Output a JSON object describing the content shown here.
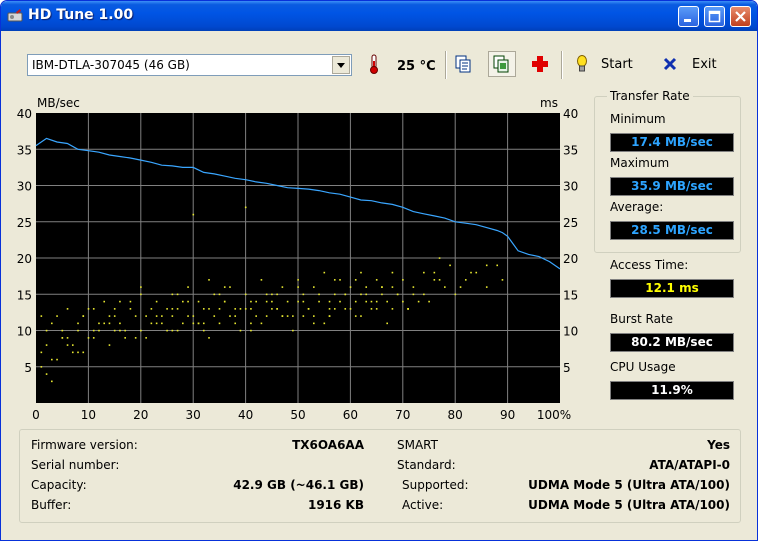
{
  "window": {
    "title": "HD Tune 1.00"
  },
  "toolbar": {
    "drive_selected": "IBM-DTLA-307045 (46 GB)",
    "temperature": "25 °C",
    "start_label": "Start",
    "exit_label": "Exit"
  },
  "transfer_rate": {
    "group_title": "Transfer Rate",
    "minimum_label": "Minimum",
    "minimum_value": "17.4 MB/sec",
    "maximum_label": "Maximum",
    "maximum_value": "35.9 MB/sec",
    "average_label": "Average:",
    "average_value": "28.5 MB/sec"
  },
  "access_time": {
    "label": "Access Time:",
    "value": "12.1 ms"
  },
  "burst_rate": {
    "label": "Burst Rate",
    "value": "80.2 MB/sec"
  },
  "cpu_usage": {
    "label": "CPU Usage",
    "value": "11.9%"
  },
  "info": {
    "firmware_label": "Firmware version:",
    "firmware_value": "TX6OA6AA",
    "serial_label": "Serial number:",
    "serial_value": "",
    "capacity_label": "Capacity:",
    "capacity_value": "42.9 GB (~46.1 GB)",
    "buffer_label": "Buffer:",
    "buffer_value": "1916 KB",
    "smart_label": "SMART",
    "smart_value": "Yes",
    "standard_label": "Standard:",
    "standard_value": "ATA/ATAPI-0",
    "supported_label": "Supported:",
    "supported_value": "UDMA Mode 5 (Ultra ATA/100)",
    "active_label": "Active:",
    "active_value": "UDMA Mode 5 (Ultra ATA/100)"
  },
  "colors": {
    "plot_bg": "#000000",
    "grid": "#808080",
    "transfer_line": "#3aa6ff",
    "access_dots": "#e8e830"
  },
  "chart_data": {
    "type": "line",
    "ylabel_left": "MB/sec",
    "ylabel_right": "ms",
    "x_ticks": [
      "0",
      "10",
      "20",
      "30",
      "40",
      "50",
      "60",
      "70",
      "80",
      "90",
      "100%"
    ],
    "y_ticks": [
      "5",
      "10",
      "15",
      "20",
      "25",
      "30",
      "35",
      "40"
    ],
    "xlim": [
      0,
      100
    ],
    "ylim": [
      0,
      40
    ],
    "grid": true,
    "series": [
      {
        "x": [
          0,
          2,
          4,
          6,
          8,
          10,
          12,
          14,
          16,
          18,
          20,
          22,
          24,
          26,
          28,
          30,
          32,
          34,
          36,
          38,
          40,
          42,
          44,
          46,
          48,
          50,
          52,
          54,
          56,
          58,
          60,
          62,
          64,
          66,
          68,
          70,
          72,
          74,
          76,
          78,
          80,
          82,
          84,
          86,
          88,
          89,
          90,
          91,
          92,
          94,
          96,
          98,
          100
        ],
        "values": [
          35.5,
          36.5,
          36.0,
          35.8,
          35.0,
          34.8,
          34.6,
          34.2,
          34.0,
          33.8,
          33.5,
          33.2,
          32.8,
          32.7,
          32.5,
          32.5,
          31.8,
          31.6,
          31.3,
          31.0,
          30.8,
          30.5,
          30.3,
          30.0,
          29.7,
          29.6,
          29.5,
          29.3,
          29.0,
          28.8,
          28.4,
          28.0,
          27.9,
          27.6,
          27.4,
          27.0,
          26.4,
          26.1,
          25.8,
          25.5,
          25.0,
          24.8,
          24.6,
          24.2,
          23.8,
          23.5,
          23.0,
          22.0,
          21.0,
          20.5,
          20.2,
          19.5,
          18.5
        ]
      },
      {
        "x": [
          1,
          2,
          3,
          4,
          5,
          6,
          7,
          8,
          9,
          10,
          12,
          13,
          14,
          15,
          16,
          18,
          19,
          20,
          22,
          23,
          24,
          25,
          26,
          27,
          28,
          29,
          30,
          31,
          32,
          33,
          34,
          35,
          36,
          37,
          38,
          39,
          40,
          41,
          42,
          43,
          44,
          45,
          46,
          47,
          48,
          49,
          50,
          51,
          52,
          53,
          54,
          55,
          56,
          57,
          58,
          59,
          60,
          61,
          62,
          63,
          64,
          65,
          66,
          67,
          68,
          69,
          70,
          71,
          72,
          74,
          75,
          76,
          78,
          79,
          80,
          82,
          84,
          86,
          88,
          2,
          4,
          6,
          8,
          10,
          12,
          14,
          16,
          18,
          20,
          22,
          24,
          26,
          28,
          30,
          32,
          34,
          36,
          38,
          40,
          42,
          44,
          46,
          48,
          50,
          52,
          54,
          56,
          58,
          60,
          62,
          64,
          66,
          68,
          70,
          72,
          1,
          3,
          5,
          7,
          9,
          11,
          13,
          15,
          17,
          19,
          21,
          23,
          25,
          27,
          29,
          31,
          33,
          35,
          37,
          39,
          41,
          43,
          45,
          47,
          49,
          51,
          53,
          55,
          57,
          59,
          61,
          63,
          65,
          67,
          69,
          71,
          73,
          2,
          5,
          8,
          11,
          14,
          17,
          20,
          23,
          26,
          29,
          32,
          35,
          38,
          41,
          44,
          47,
          50,
          53,
          56,
          59,
          62,
          65,
          68,
          71,
          74,
          77,
          1,
          6,
          11,
          16,
          21,
          26,
          31,
          36,
          41,
          46,
          51,
          56,
          61,
          66,
          71,
          76,
          81,
          86,
          3,
          9,
          15,
          27,
          33,
          45,
          57,
          63,
          77,
          83,
          89,
          30,
          40
        ],
        "values": [
          5,
          8,
          11,
          6,
          9,
          13,
          7,
          10,
          12,
          9,
          11,
          14,
          8,
          12,
          10,
          13,
          9,
          15,
          11,
          14,
          12,
          10,
          15,
          13,
          11,
          16,
          12,
          14,
          10,
          13,
          15,
          11,
          14,
          16,
          12,
          13,
          15,
          11,
          14,
          17,
          12,
          15,
          13,
          16,
          14,
          12,
          17,
          15,
          13,
          16,
          14,
          18,
          12,
          15,
          17,
          13,
          16,
          14,
          18,
          15,
          13,
          17,
          16,
          14,
          18,
          15,
          17,
          13,
          16,
          18,
          14,
          17,
          16,
          19,
          15,
          17,
          18,
          16,
          19,
          10,
          12,
          9,
          11,
          13,
          10,
          12,
          11,
          14,
          10,
          13,
          11,
          12,
          14,
          11,
          13,
          12,
          14,
          11,
          13,
          12,
          15,
          13,
          12,
          14,
          13,
          15,
          12,
          14,
          13,
          15,
          14,
          16,
          13,
          14,
          15,
          7,
          6,
          10,
          8,
          12,
          9,
          11,
          13,
          10,
          12,
          9,
          11,
          13,
          10,
          12,
          11,
          9,
          13,
          12,
          10,
          14,
          11,
          13,
          12,
          10,
          14,
          12,
          11,
          13,
          15,
          12,
          14,
          13,
          11,
          15,
          13,
          14,
          4,
          9,
          7,
          13,
          11,
          9,
          16,
          12,
          10,
          14,
          11,
          15,
          13,
          10,
          14,
          12,
          16,
          11,
          13,
          15,
          12,
          14,
          16,
          13,
          15,
          17,
          12,
          8,
          10,
          14,
          12,
          13,
          11,
          16,
          13,
          15,
          12,
          14,
          17,
          15,
          13,
          18,
          16,
          19,
          3,
          7,
          10,
          15,
          17,
          14,
          17,
          16,
          20,
          18,
          17,
          26,
          27
        ]
      }
    ]
  }
}
